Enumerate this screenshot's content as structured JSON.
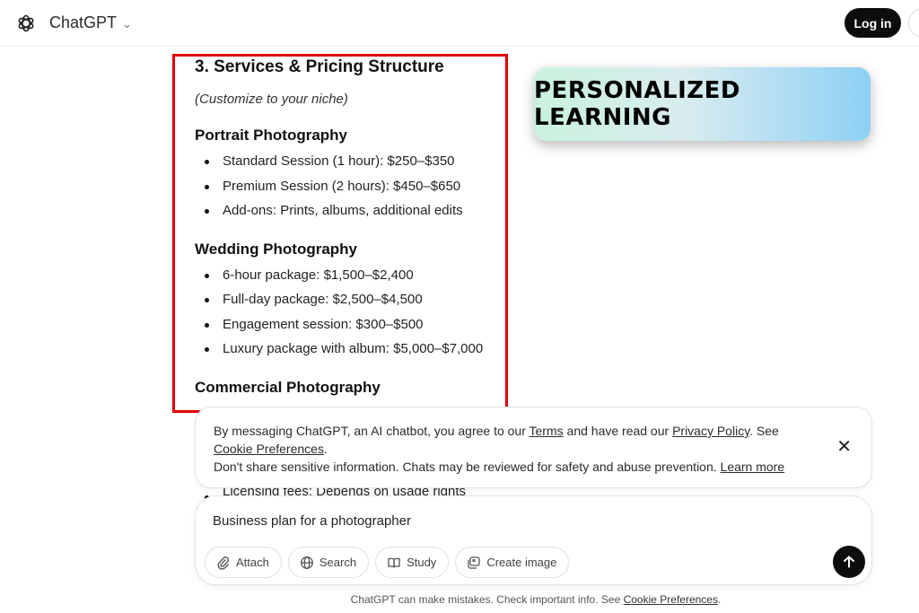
{
  "app": {
    "brand": "ChatGPT",
    "login_label": "Log in"
  },
  "content": {
    "section_title": "3. Services & Pricing Structure",
    "note": "(Customize to your niche)",
    "groups": [
      {
        "heading": "Portrait Photography",
        "items": [
          "Standard Session (1 hour): $250–$350",
          "Premium Session (2 hours): $450–$650",
          "Add-ons: Prints, albums, additional edits"
        ]
      },
      {
        "heading": "Wedding Photography",
        "items": [
          "6-hour package: $1,500–$2,400",
          "Full-day package: $2,500–$4,500",
          "Engagement session: $300–$500",
          "Luxury package with album: $5,000–$7,000"
        ]
      },
      {
        "heading": "Commercial Photography",
        "items": []
      }
    ],
    "peek_text": "Licensing fees: Depends on usage rights"
  },
  "badge": {
    "text": "PERSONALIZED LEARNING"
  },
  "notice": {
    "part1": "By messaging ChatGPT, an AI chatbot, you agree to our ",
    "terms_link": "Terms",
    "part2": " and have read our ",
    "privacy_link": "Privacy Policy",
    "part3": ". See",
    "cookie_link": "Cookie Preferences",
    "part4": ".",
    "line2": "Don't share sensitive information. Chats may be reviewed for safety and abuse prevention. ",
    "learn_link": "Learn more",
    "close_glyph": "✕"
  },
  "composer": {
    "input_value": "Business plan for a photographer",
    "tools": [
      "Attach",
      "Search",
      "Study",
      "Create image"
    ]
  },
  "footer": {
    "text": "ChatGPT can make mistakes. Check important info. See ",
    "link": "Cookie Preferences",
    "end": "."
  },
  "colors": {
    "highlight_border": "#e00000",
    "badge_gradient_start": "#c9f2dd",
    "badge_gradient_end": "#8dd0f5",
    "dark": "#0d0d0d"
  }
}
